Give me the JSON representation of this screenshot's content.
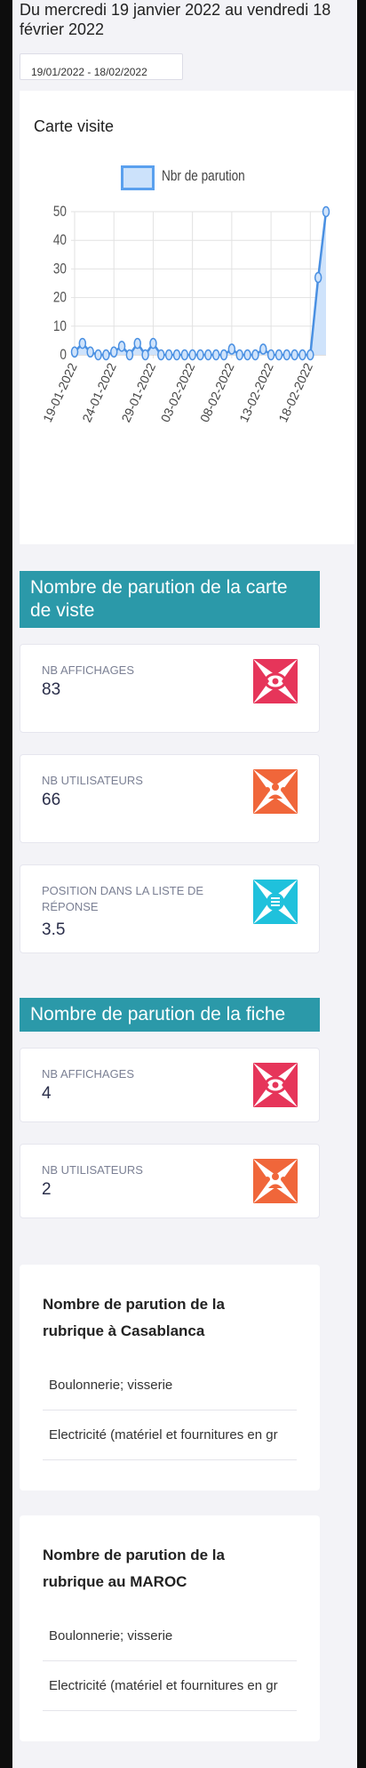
{
  "period_text": "Du mercredi 19 janvier 2022 au vendredi 18 février 2022",
  "date_range_value": "19/01/2022 - 18/02/2022",
  "chart_card": {
    "title": "Carte visite",
    "legend_color": "#5aa0ee"
  },
  "chart_data": {
    "type": "line",
    "title": "",
    "series": [
      {
        "name": "Nbr de parution",
        "color": "#4a90e2",
        "values": [
          1,
          4,
          1,
          0,
          0,
          1,
          3,
          0,
          4,
          0,
          4,
          0,
          0,
          0,
          0,
          0,
          0,
          0,
          0,
          0,
          2,
          0,
          0,
          0,
          2,
          0,
          0,
          0,
          0,
          0,
          0,
          27,
          50
        ]
      }
    ],
    "x_tick_labels": [
      "19-01-2022",
      "24-01-2022",
      "29-01-2022",
      "03-02-2022",
      "08-02-2022",
      "13-02-2022",
      "18-02-2022"
    ],
    "y_tick_labels": [
      "50",
      "40",
      "30",
      "20",
      "10",
      "0"
    ],
    "ylim": [
      0,
      50
    ],
    "grid": true,
    "legend_position": "top"
  },
  "section_carte": {
    "header": "Nombre de parution de la carte de viste",
    "stats": [
      {
        "label": "NB AFFICHAGES",
        "value": "83",
        "icon": "eye-icon",
        "color": "#e6355a"
      },
      {
        "label": "NB UTILISATEURS",
        "value": "66",
        "icon": "users-icon",
        "color": "#f0663a"
      },
      {
        "label": "POSITION DANS LA LISTE DE RÉPONSE",
        "value": "3.5",
        "icon": "list-icon",
        "color": "#1fc1dc"
      }
    ]
  },
  "section_fiche": {
    "header": "Nombre de parution de la fiche",
    "stats": [
      {
        "label": "NB AFFICHAGES",
        "value": "4",
        "icon": "eye-icon",
        "color": "#e6355a"
      },
      {
        "label": "NB UTILISATEURS",
        "value": "2",
        "icon": "users-icon",
        "color": "#f0663a"
      }
    ]
  },
  "rubrique_casablanca": {
    "title": "Nombre de parution de la rubrique à Casablanca",
    "items": [
      "Boulonnerie; visserie",
      "Electricité (matériel et fournitures en gr"
    ]
  },
  "rubrique_maroc": {
    "title": "Nombre de parution de la rubrique au MAROC",
    "items": [
      "Boulonnerie; visserie",
      "Electricité (matériel et fournitures en gr"
    ]
  }
}
